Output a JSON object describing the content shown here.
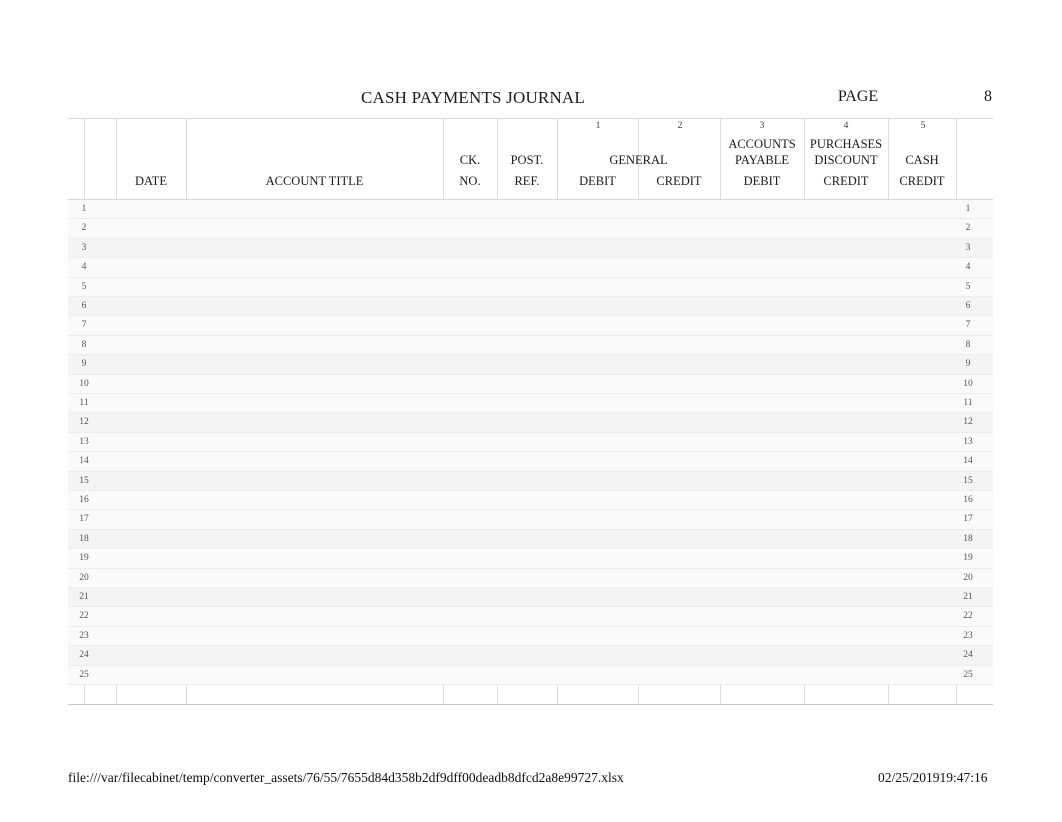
{
  "document": {
    "title": "CASH PAYMENTS JOURNAL",
    "page_label": "PAGE",
    "page_number": "8"
  },
  "table": {
    "column_numbers": [
      "1",
      "2",
      "3",
      "4",
      "5"
    ],
    "headers": {
      "date": "DATE",
      "account_title": "ACCOUNT TITLE",
      "ck_no_line1": "CK.",
      "ck_no_line2": "NO.",
      "post_ref_line1": "POST.",
      "post_ref_line2": "REF.",
      "general_group": "GENERAL",
      "general_debit": "DEBIT",
      "general_credit": "CREDIT",
      "accounts_payable_line1": "ACCOUNTS",
      "accounts_payable_line2": "PAYABLE",
      "accounts_payable_line3": "DEBIT",
      "purchases_discount_line1": "PURCHASES",
      "purchases_discount_line2": "DISCOUNT",
      "purchases_discount_line3": "CREDIT",
      "cash_line2": "CASH",
      "cash_line3": "CREDIT"
    },
    "row_numbers": [
      "1",
      "2",
      "3",
      "4",
      "5",
      "6",
      "7",
      "8",
      "9",
      "10",
      "11",
      "12",
      "13",
      "14",
      "15",
      "16",
      "17",
      "18",
      "19",
      "20",
      "21",
      "22",
      "23",
      "24",
      "25"
    ],
    "rows": [
      {
        "date_month": "",
        "date_day": "",
        "account_title": "",
        "ck_no": "",
        "post_ref": "",
        "general_debit": "",
        "general_credit": "",
        "accounts_payable_debit": "",
        "purchases_discount_credit": "",
        "cash_credit": ""
      },
      {
        "date_month": "",
        "date_day": "",
        "account_title": "",
        "ck_no": "",
        "post_ref": "",
        "general_debit": "",
        "general_credit": "",
        "accounts_payable_debit": "",
        "purchases_discount_credit": "",
        "cash_credit": ""
      },
      {
        "date_month": "",
        "date_day": "",
        "account_title": "",
        "ck_no": "",
        "post_ref": "",
        "general_debit": "",
        "general_credit": "",
        "accounts_payable_debit": "",
        "purchases_discount_credit": "",
        "cash_credit": ""
      },
      {
        "date_month": "",
        "date_day": "",
        "account_title": "",
        "ck_no": "",
        "post_ref": "",
        "general_debit": "",
        "general_credit": "",
        "accounts_payable_debit": "",
        "purchases_discount_credit": "",
        "cash_credit": ""
      },
      {
        "date_month": "",
        "date_day": "",
        "account_title": "",
        "ck_no": "",
        "post_ref": "",
        "general_debit": "",
        "general_credit": "",
        "accounts_payable_debit": "",
        "purchases_discount_credit": "",
        "cash_credit": ""
      },
      {
        "date_month": "",
        "date_day": "",
        "account_title": "",
        "ck_no": "",
        "post_ref": "",
        "general_debit": "",
        "general_credit": "",
        "accounts_payable_debit": "",
        "purchases_discount_credit": "",
        "cash_credit": ""
      },
      {
        "date_month": "",
        "date_day": "",
        "account_title": "",
        "ck_no": "",
        "post_ref": "",
        "general_debit": "",
        "general_credit": "",
        "accounts_payable_debit": "",
        "purchases_discount_credit": "",
        "cash_credit": ""
      },
      {
        "date_month": "",
        "date_day": "",
        "account_title": "",
        "ck_no": "",
        "post_ref": "",
        "general_debit": "",
        "general_credit": "",
        "accounts_payable_debit": "",
        "purchases_discount_credit": "",
        "cash_credit": ""
      },
      {
        "date_month": "",
        "date_day": "",
        "account_title": "",
        "ck_no": "",
        "post_ref": "",
        "general_debit": "",
        "general_credit": "",
        "accounts_payable_debit": "",
        "purchases_discount_credit": "",
        "cash_credit": ""
      },
      {
        "date_month": "",
        "date_day": "",
        "account_title": "",
        "ck_no": "",
        "post_ref": "",
        "general_debit": "",
        "general_credit": "",
        "accounts_payable_debit": "",
        "purchases_discount_credit": "",
        "cash_credit": ""
      },
      {
        "date_month": "",
        "date_day": "",
        "account_title": "",
        "ck_no": "",
        "post_ref": "",
        "general_debit": "",
        "general_credit": "",
        "accounts_payable_debit": "",
        "purchases_discount_credit": "",
        "cash_credit": ""
      },
      {
        "date_month": "",
        "date_day": "",
        "account_title": "",
        "ck_no": "",
        "post_ref": "",
        "general_debit": "",
        "general_credit": "",
        "accounts_payable_debit": "",
        "purchases_discount_credit": "",
        "cash_credit": ""
      },
      {
        "date_month": "",
        "date_day": "",
        "account_title": "",
        "ck_no": "",
        "post_ref": "",
        "general_debit": "",
        "general_credit": "",
        "accounts_payable_debit": "",
        "purchases_discount_credit": "",
        "cash_credit": ""
      },
      {
        "date_month": "",
        "date_day": "",
        "account_title": "",
        "ck_no": "",
        "post_ref": "",
        "general_debit": "",
        "general_credit": "",
        "accounts_payable_debit": "",
        "purchases_discount_credit": "",
        "cash_credit": ""
      },
      {
        "date_month": "",
        "date_day": "",
        "account_title": "",
        "ck_no": "",
        "post_ref": "",
        "general_debit": "",
        "general_credit": "",
        "accounts_payable_debit": "",
        "purchases_discount_credit": "",
        "cash_credit": ""
      },
      {
        "date_month": "",
        "date_day": "",
        "account_title": "",
        "ck_no": "",
        "post_ref": "",
        "general_debit": "",
        "general_credit": "",
        "accounts_payable_debit": "",
        "purchases_discount_credit": "",
        "cash_credit": ""
      },
      {
        "date_month": "",
        "date_day": "",
        "account_title": "",
        "ck_no": "",
        "post_ref": "",
        "general_debit": "",
        "general_credit": "",
        "accounts_payable_debit": "",
        "purchases_discount_credit": "",
        "cash_credit": ""
      },
      {
        "date_month": "",
        "date_day": "",
        "account_title": "",
        "ck_no": "",
        "post_ref": "",
        "general_debit": "",
        "general_credit": "",
        "accounts_payable_debit": "",
        "purchases_discount_credit": "",
        "cash_credit": ""
      },
      {
        "date_month": "",
        "date_day": "",
        "account_title": "",
        "ck_no": "",
        "post_ref": "",
        "general_debit": "",
        "general_credit": "",
        "accounts_payable_debit": "",
        "purchases_discount_credit": "",
        "cash_credit": ""
      },
      {
        "date_month": "",
        "date_day": "",
        "account_title": "",
        "ck_no": "",
        "post_ref": "",
        "general_debit": "",
        "general_credit": "",
        "accounts_payable_debit": "",
        "purchases_discount_credit": "",
        "cash_credit": ""
      },
      {
        "date_month": "",
        "date_day": "",
        "account_title": "",
        "ck_no": "",
        "post_ref": "",
        "general_debit": "",
        "general_credit": "",
        "accounts_payable_debit": "",
        "purchases_discount_credit": "",
        "cash_credit": ""
      },
      {
        "date_month": "",
        "date_day": "",
        "account_title": "",
        "ck_no": "",
        "post_ref": "",
        "general_debit": "",
        "general_credit": "",
        "accounts_payable_debit": "",
        "purchases_discount_credit": "",
        "cash_credit": ""
      },
      {
        "date_month": "",
        "date_day": "",
        "account_title": "",
        "ck_no": "",
        "post_ref": "",
        "general_debit": "",
        "general_credit": "",
        "accounts_payable_debit": "",
        "purchases_discount_credit": "",
        "cash_credit": ""
      },
      {
        "date_month": "",
        "date_day": "",
        "account_title": "",
        "ck_no": "",
        "post_ref": "",
        "general_debit": "",
        "general_credit": "",
        "accounts_payable_debit": "",
        "purchases_discount_credit": "",
        "cash_credit": ""
      },
      {
        "date_month": "",
        "date_day": "",
        "account_title": "",
        "ck_no": "",
        "post_ref": "",
        "general_debit": "",
        "general_credit": "",
        "accounts_payable_debit": "",
        "purchases_discount_credit": "",
        "cash_credit": ""
      }
    ]
  },
  "footer": {
    "file_path": "file:///var/filecabinet/temp/converter_assets/76/55/7655d84d358b2df9dff00deadb8dfcd2a8e99727.xlsx",
    "timestamp": "02/25/201919:47:16"
  },
  "colors": {
    "page_background": "#ffffff",
    "text": "#1a1a1a",
    "grid_line": "#dcdcdc",
    "row_band": "#f4f4f4"
  }
}
